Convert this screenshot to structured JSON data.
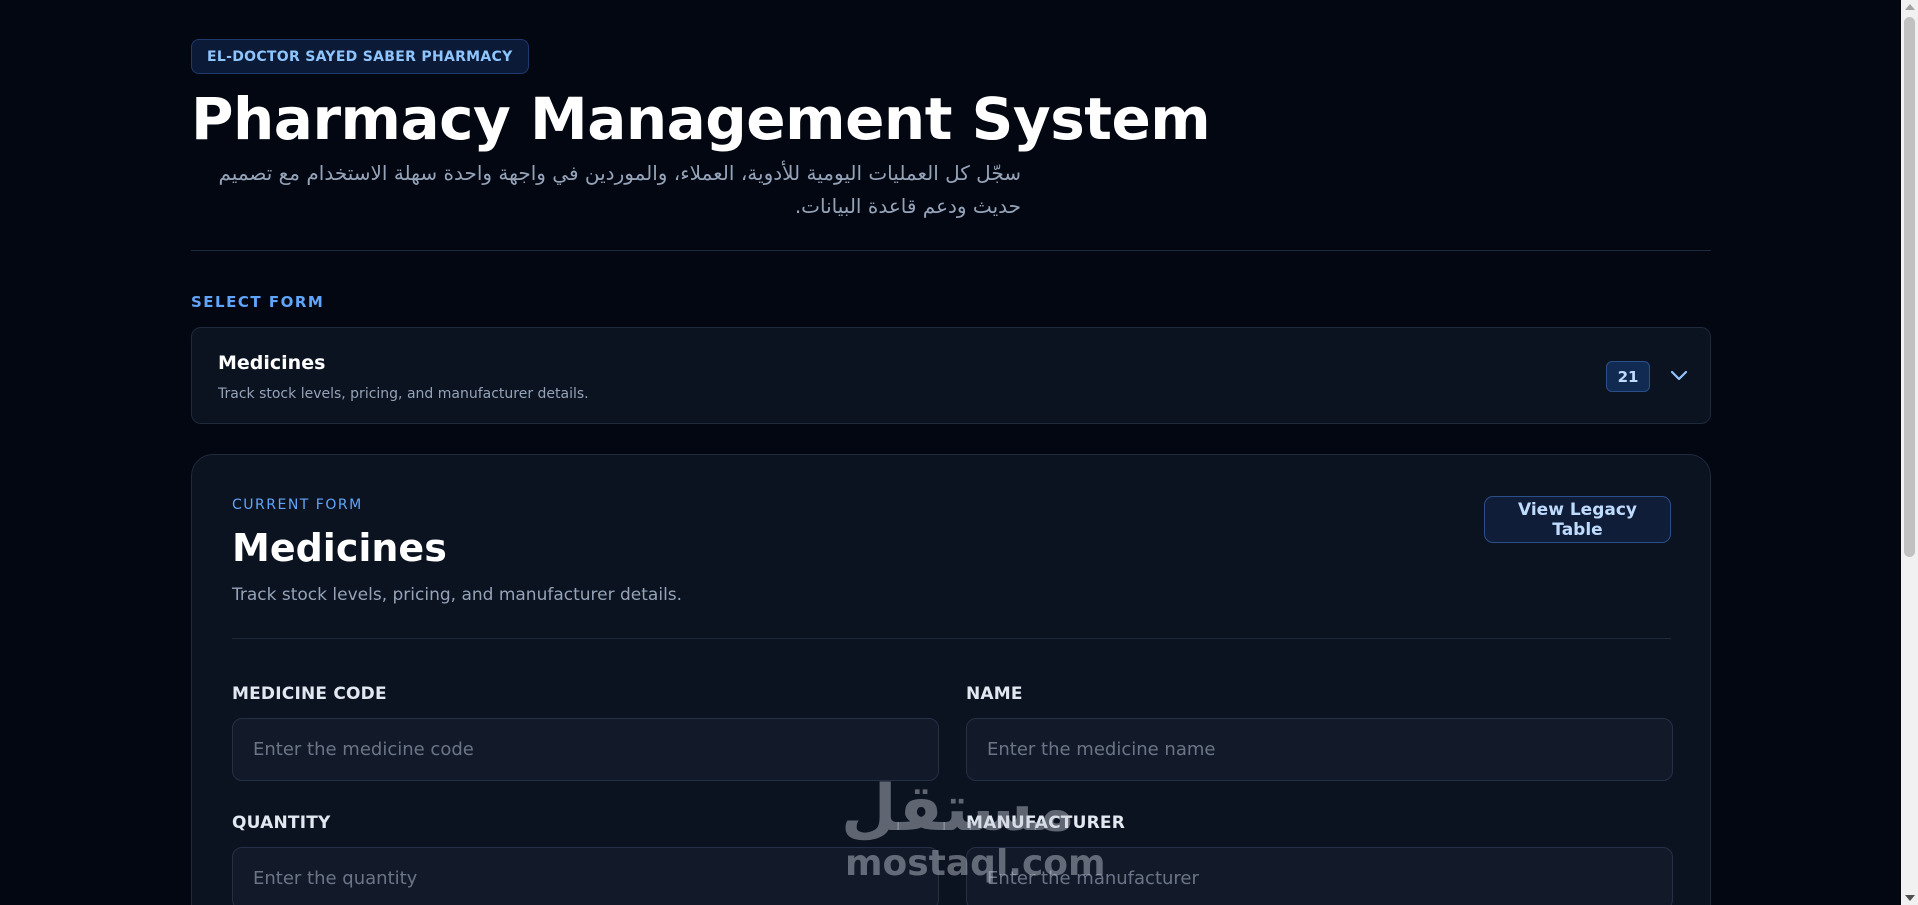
{
  "header": {
    "badge": "EL-DOCTOR SAYED SABER PHARMACY",
    "title": "Pharmacy Management System",
    "subtitle": "سجّل كل العمليات اليومية للأدوية، العملاء، والموردين في واجهة واحدة سهلة الاستخدام مع تصميم حديث ودعم قاعدة البيانات."
  },
  "select_form": {
    "label": "SELECT FORM",
    "selected_title": "Medicines",
    "selected_description": "Track stock levels, pricing, and manufacturer details.",
    "count": "21",
    "icon": "chevron-down-icon"
  },
  "current_form": {
    "label": "CURRENT FORM",
    "title": "Medicines",
    "description": "Track stock levels, pricing, and manufacturer details.",
    "legacy_button_label": "View Legacy Table",
    "fields": [
      {
        "label": "MEDICINE CODE",
        "placeholder": "Enter the medicine code",
        "value": ""
      },
      {
        "label": "NAME",
        "placeholder": "Enter the medicine name",
        "value": ""
      },
      {
        "label": "QUANTITY",
        "placeholder": "Enter the quantity",
        "value": ""
      },
      {
        "label": "MANUFACTURER",
        "placeholder": "Enter the manufacturer",
        "value": ""
      }
    ]
  },
  "watermark": {
    "arabic": "مستقل",
    "latin": "mostaql.com"
  },
  "colors": {
    "background": "#030712",
    "card": "#0b1220",
    "accent": "#60a5fa",
    "badge_text": "#8ec5ff",
    "muted_text": "#94a3b8"
  }
}
